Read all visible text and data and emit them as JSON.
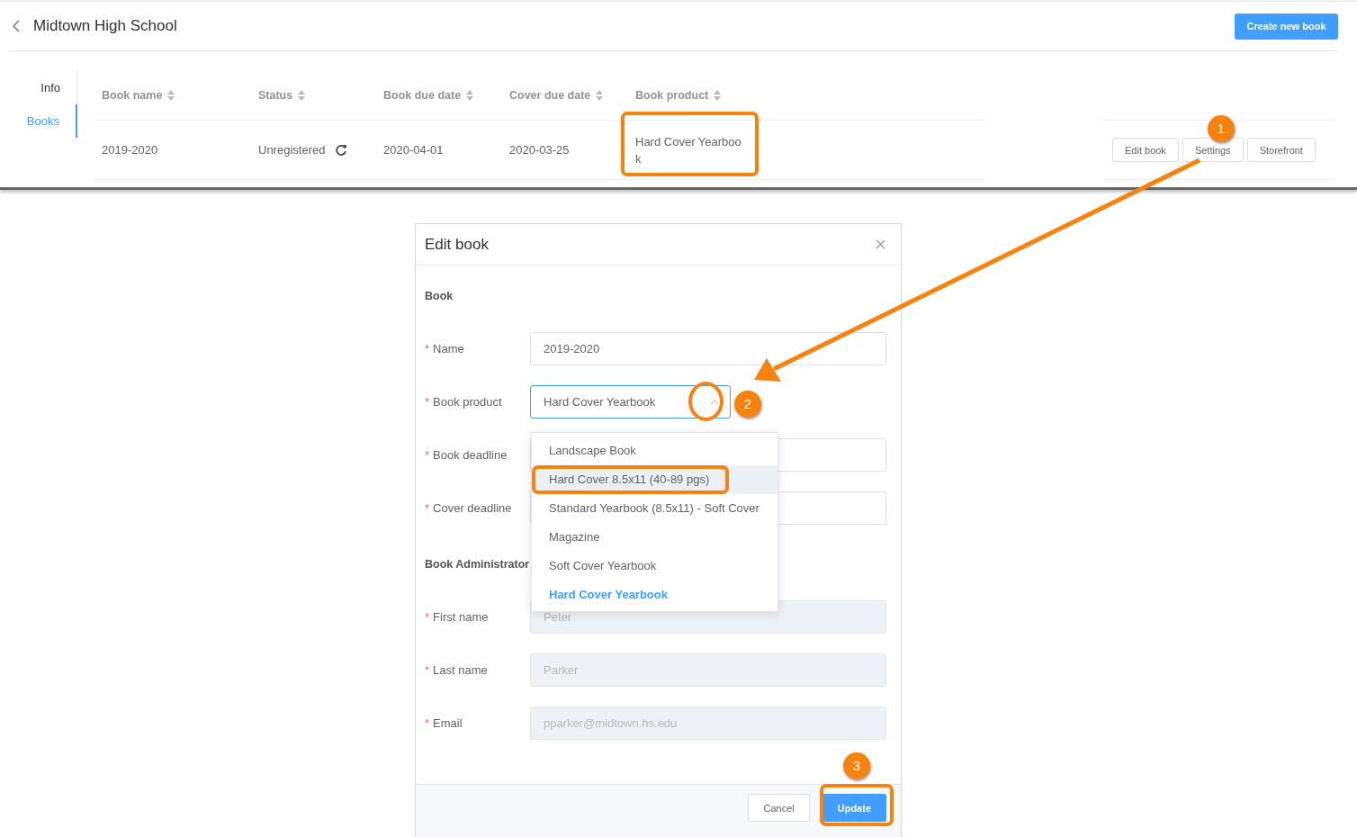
{
  "header": {
    "title": "Midtown High School",
    "create_button": "Create new book"
  },
  "side_tabs": [
    {
      "label": "Info",
      "selected": false
    },
    {
      "label": "Books",
      "selected": true
    }
  ],
  "table": {
    "columns": [
      "Book name",
      "Status",
      "Book due date",
      "Cover due date",
      "Book product"
    ],
    "rows": [
      {
        "cells": [
          "2019-2020",
          "Unregistered",
          "2020-04-01",
          "2020-03-25",
          "Hard Cover Yearbook"
        ],
        "actions": [
          "Edit book",
          "Settings",
          "Storefront"
        ]
      }
    ]
  },
  "dialog": {
    "title": "Edit book",
    "required_mark": "*",
    "sections": [
      {
        "heading": "Book",
        "fields": [
          {
            "label": "Name",
            "kind": "text",
            "value": "2019-2020"
          },
          {
            "label": "Book product",
            "kind": "select",
            "value": "Hard Cover Yearbook",
            "open": true
          },
          {
            "label": "Book deadline",
            "kind": "text"
          },
          {
            "label": "Cover deadline",
            "kind": "text"
          }
        ]
      },
      {
        "heading": "Book Administrator",
        "fields": [
          {
            "label": "First name",
            "kind": "text",
            "placeholder": "Peter",
            "disabled": true
          },
          {
            "label": "Last name",
            "kind": "text",
            "placeholder": "Parker",
            "disabled": true
          },
          {
            "label": "Email",
            "kind": "text",
            "placeholder": "pparker@midtown.hs.edu",
            "disabled": true
          }
        ]
      }
    ],
    "dropdown": [
      {
        "label": "Landscape Book",
        "selected": false,
        "hovered": false
      },
      {
        "label": "Hard Cover 8.5x11 (40-89 pgs)",
        "selected": false,
        "hovered": true
      },
      {
        "label": "Standard Yearbook (8.5x11) - Soft Cover",
        "selected": false,
        "hovered": false
      },
      {
        "label": "Magazine",
        "selected": false,
        "hovered": false
      },
      {
        "label": "Soft Cover Yearbook",
        "selected": false,
        "hovered": false
      },
      {
        "label": "Hard Cover Yearbook",
        "selected": true,
        "hovered": false
      }
    ],
    "buttons": [
      {
        "label": "Cancel",
        "kind": "secondary"
      },
      {
        "label": "Update",
        "kind": "primary"
      }
    ]
  },
  "steps": [
    {
      "number": "1"
    },
    {
      "number": "2"
    },
    {
      "number": "3"
    }
  ]
}
